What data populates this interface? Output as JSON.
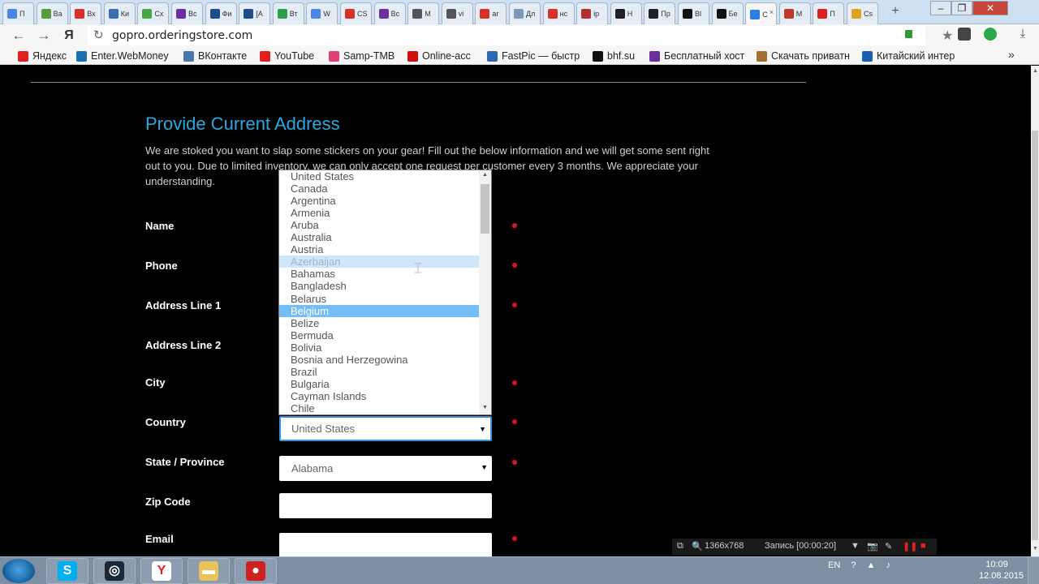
{
  "browser": {
    "tabs": [
      {
        "label": "П",
        "color": "#4a86e8"
      },
      {
        "label": "Ва",
        "color": "#5a9a3a"
      },
      {
        "label": "Вх",
        "color": "#d93025"
      },
      {
        "label": "Ки",
        "color": "#3b6fb0"
      },
      {
        "label": "Сх",
        "color": "#48a845"
      },
      {
        "label": "Вс",
        "color": "#6b2fa0"
      },
      {
        "label": "Фи",
        "color": "#1e4d8c"
      },
      {
        "label": "[А",
        "color": "#1e4d8c"
      },
      {
        "label": "Вт",
        "color": "#2e9e4f"
      },
      {
        "label": "W",
        "color": "#4a86e8"
      },
      {
        "label": "CS",
        "color": "#d93025"
      },
      {
        "label": "Вс",
        "color": "#6b2fa0"
      },
      {
        "label": "М",
        "color": "#555555"
      },
      {
        "label": "vi",
        "color": "#555555"
      },
      {
        "label": "ar",
        "color": "#d93025"
      },
      {
        "label": "Дл",
        "color": "#7c9ab8"
      },
      {
        "label": "нс",
        "color": "#d93025"
      },
      {
        "label": "ip",
        "color": "#b03030"
      },
      {
        "label": "Н",
        "color": "#222222"
      },
      {
        "label": "Пр",
        "color": "#222222"
      },
      {
        "label": "Вl",
        "color": "#111111"
      },
      {
        "label": "Бе",
        "color": "#111111"
      },
      {
        "label": "С",
        "color": "#2a7de1",
        "active": true
      },
      {
        "label": "М",
        "color": "#c0392b"
      },
      {
        "label": "П",
        "color": "#e02020"
      },
      {
        "label": "Cs",
        "color": "#e0a020"
      }
    ],
    "url": "gopro.orderingstore.com",
    "bookmarks": [
      {
        "label": "Яндекс",
        "color": "#e02020"
      },
      {
        "label": "Enter.WebMoney",
        "color": "#1a6fb0"
      },
      {
        "label": "ВКонтакте",
        "color": "#4a76a8"
      },
      {
        "label": "YouTube",
        "color": "#e02020"
      },
      {
        "label": "Samp-TMB",
        "color": "#e0407a"
      },
      {
        "label": "Online-acc",
        "color": "#d01010"
      },
      {
        "label": "FastPic — быстр",
        "color": "#2a6ab0"
      },
      {
        "label": "bhf.su",
        "color": "#111111"
      },
      {
        "label": "Бесплатный хост",
        "color": "#6b2fa0"
      },
      {
        "label": "Скачать приватн",
        "color": "#a07030"
      },
      {
        "label": "Китайский интер",
        "color": "#1a5fb0"
      }
    ],
    "more": "»"
  },
  "form": {
    "title": "Provide Current Address",
    "description": "We are stoked you want to slap some stickers on your gear! Fill out the below information and we will get some sent right out to you. Due to limited inventory, we can only accept one request per customer every 3 months. We appreciate your understanding.",
    "labels": {
      "name": "Name",
      "phone": "Phone",
      "address1": "Address Line 1",
      "address2": "Address Line 2",
      "city": "City",
      "country": "Country",
      "state": "State / Province",
      "zip": "Zip Code",
      "email": "Email"
    },
    "country_value": "United States",
    "state_value": "Alabama",
    "dropdown_options": [
      "United States",
      "Canada",
      "Argentina",
      "Armenia",
      "Aruba",
      "Australia",
      "Austria",
      "Azerbaijan",
      "Bahamas",
      "Bangladesh",
      "Belarus",
      "Belgium",
      "Belize",
      "Bermuda",
      "Bolivia",
      "Bosnia and Herzegowina",
      "Brazil",
      "Bulgaria",
      "Cayman Islands",
      "Chile"
    ],
    "hover_option": "Azerbaijan",
    "selected_option": "Belgium"
  },
  "recorder": {
    "resolution": "1366x768",
    "status": "Запись [00:00:20]"
  },
  "taskbar": {
    "apps": [
      {
        "name": "skype",
        "glyph": "S",
        "color": "#00aff0"
      },
      {
        "name": "steam",
        "glyph": "◎",
        "color": "#1b2838"
      },
      {
        "name": "yandex-browser",
        "glyph": "Y",
        "color": "#ffffff"
      },
      {
        "name": "explorer",
        "glyph": "▬",
        "color": "#e8c35a"
      },
      {
        "name": "recorder",
        "glyph": "●",
        "color": "#cc2222"
      }
    ],
    "lang": "EN",
    "time": "10:09",
    "date": "12.08.2015"
  }
}
